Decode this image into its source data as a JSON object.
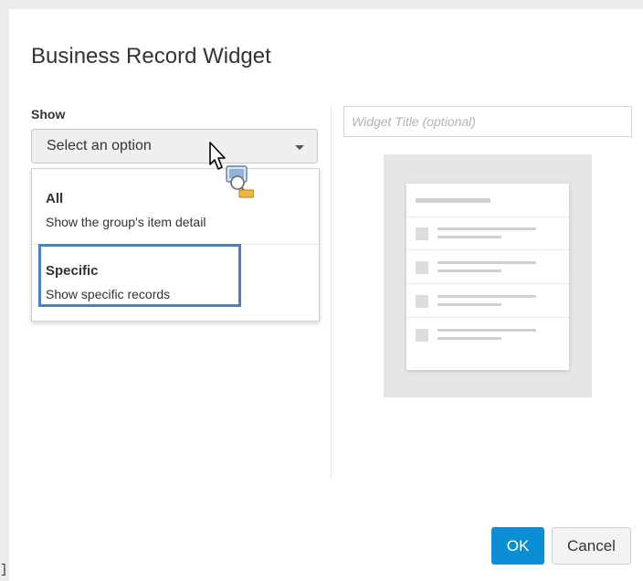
{
  "dialog": {
    "title": "Business Record Widget"
  },
  "show_section": {
    "label": "Show",
    "select": {
      "value": "Select an option",
      "icon": "chevron-down-icon"
    },
    "options": [
      {
        "title": "All",
        "description": "Show the group's item detail"
      },
      {
        "title": "Specific",
        "description": "Show specific records",
        "highlighted": true
      }
    ]
  },
  "widget_title": {
    "placeholder": "Widget Title (optional)"
  },
  "preview": {
    "icon": "widget-preview-thumbnail",
    "rows": 4
  },
  "cursor": {
    "icon": "mouse-pointer-with-drag-icon"
  },
  "buttons": {
    "ok": "OK",
    "cancel": "Cancel"
  },
  "edge_char": "]",
  "colors": {
    "primary_button": "#0a8fd6",
    "highlight_border": "#4f7ec8",
    "select_bg": "#efefef",
    "preview_bg": "#e6e6e6"
  }
}
